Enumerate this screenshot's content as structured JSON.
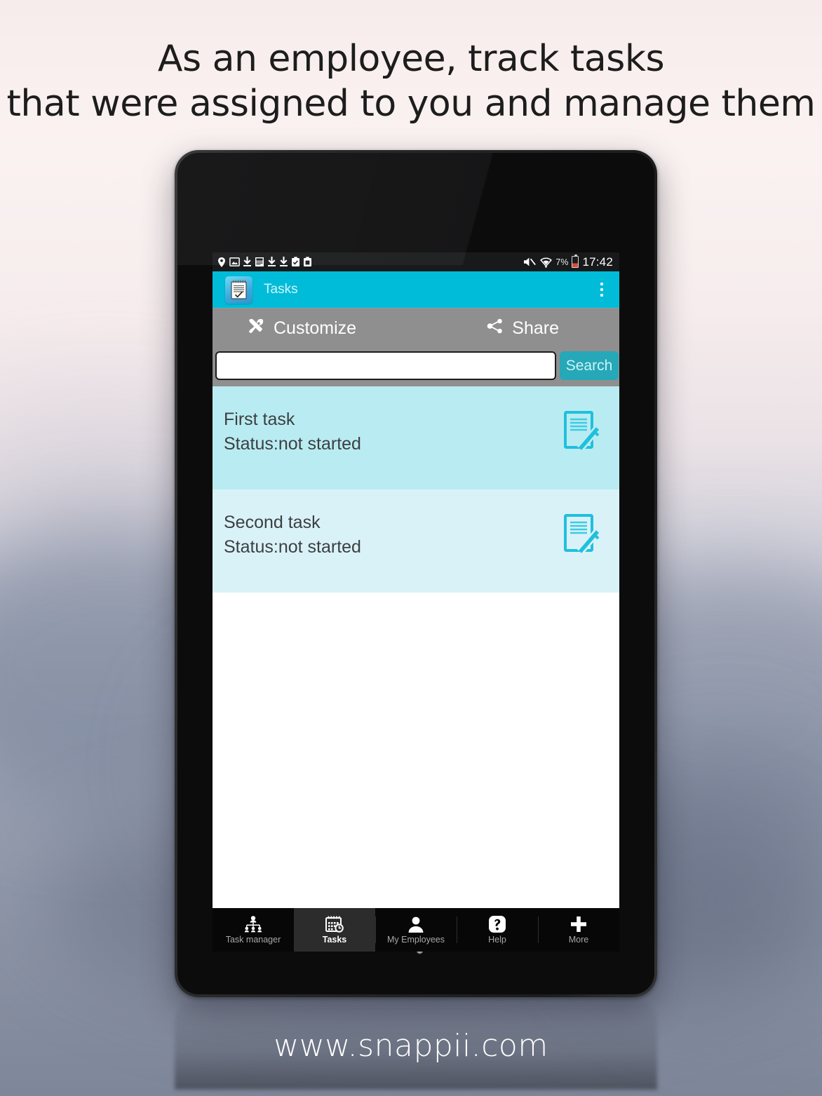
{
  "headline": {
    "line1": "As an employee, track tasks",
    "line2": "that were assigned to you and manage them"
  },
  "footer": {
    "url": "www.snappii.com"
  },
  "device": {
    "statusbar": {
      "left_icons": [
        "location-pin-icon",
        "screenshot-image-icon",
        "download-arrow-icon",
        "app-download-icon",
        "download-arrow-icon",
        "download-arrow-icon",
        "clipboard-check-icon",
        "clipboard-app-icon"
      ],
      "mute_icon": "volume-mute-icon",
      "wifi_icon": "wifi-signal-icon",
      "battery_percent": "7%",
      "battery_icon": "battery-low-icon",
      "time": "17:42"
    },
    "appbar": {
      "app_icon": "notepad-checklist-icon",
      "title": "Tasks",
      "overflow_icon": "overflow-menu-icon",
      "color": "#00bcd8"
    },
    "toolbar": {
      "customize_icon": "wrench-screwdriver-icon",
      "customize_label": "Customize",
      "share_icon": "share-nodes-icon",
      "share_label": "Share",
      "color": "#8f8f8f"
    },
    "search": {
      "value": "",
      "placeholder": "",
      "button_label": "Search",
      "button_color": "#26a8b8"
    },
    "tasks": [
      {
        "title": "First task",
        "status": "Status:not started",
        "edit_icon": "document-edit-icon",
        "row_color": "#b9ecf2"
      },
      {
        "title": "Second task",
        "status": "Status:not started",
        "edit_icon": "document-edit-icon",
        "row_color": "#d9f2f8"
      }
    ],
    "bottom_nav": [
      {
        "label": "Task manager",
        "icon": "org-chart-icon",
        "active": false
      },
      {
        "label": "Tasks",
        "icon": "calendar-clock-icon",
        "active": true
      },
      {
        "label": "My Employees",
        "icon": "person-icon",
        "active": false
      },
      {
        "label": "Help",
        "icon": "question-mark-icon",
        "active": false
      },
      {
        "label": "More",
        "icon": "plus-icon",
        "active": false
      }
    ]
  }
}
